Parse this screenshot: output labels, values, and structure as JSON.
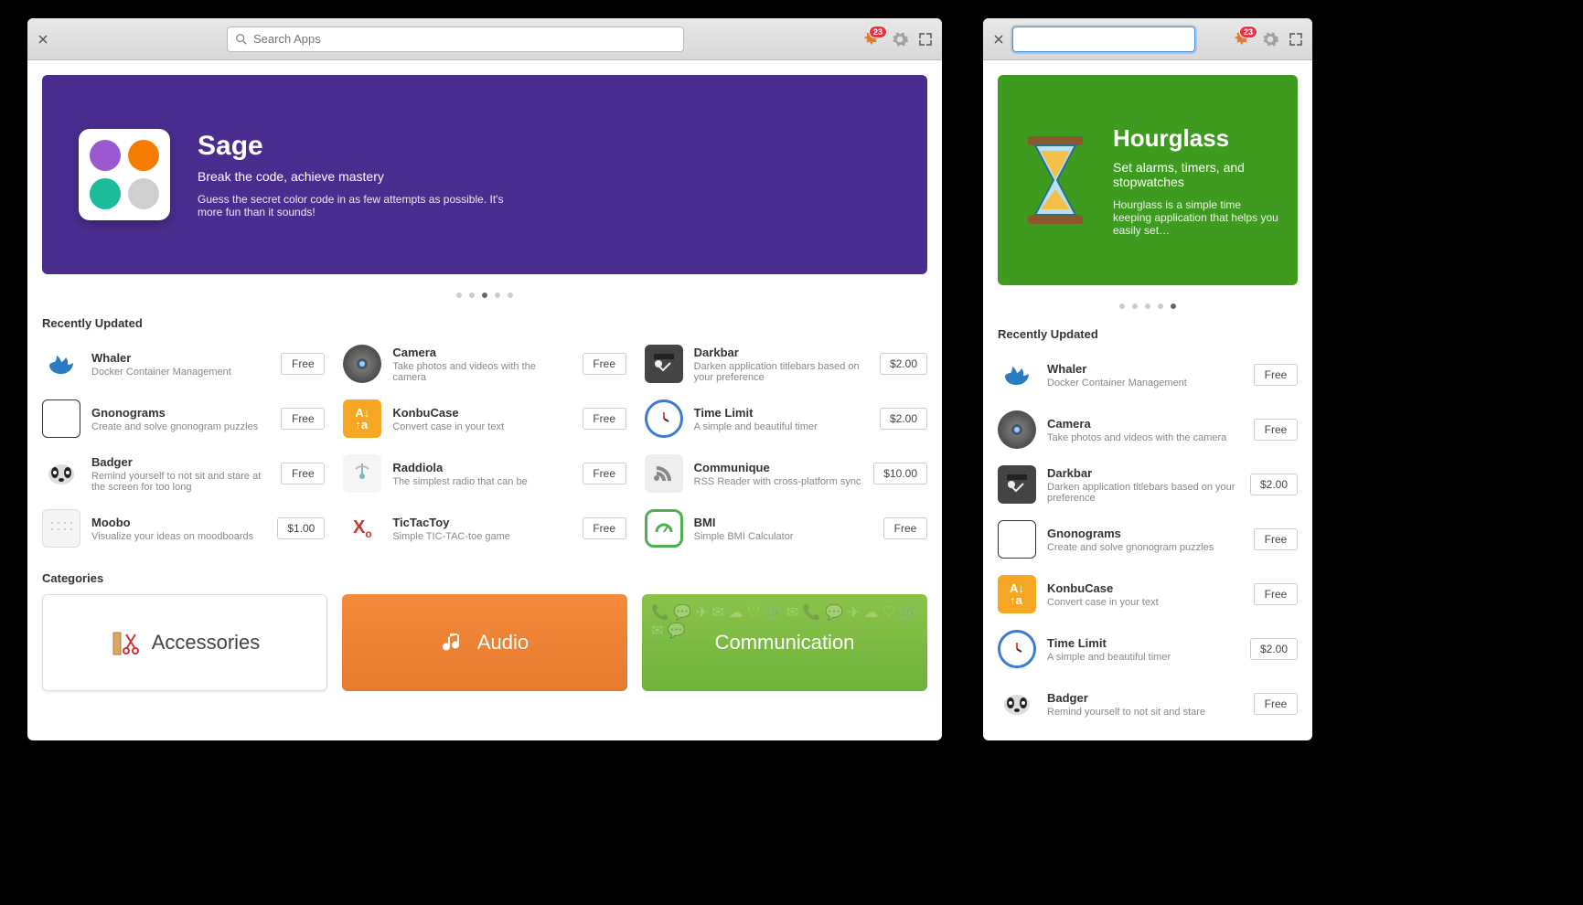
{
  "search_placeholder": "Search Apps",
  "update_count": "23",
  "hero_a": {
    "title": "Sage",
    "subtitle": "Break the code, achieve mastery",
    "description": "Guess the secret color code in as few attempts as possible. It's more fun than it sounds!",
    "icon_colors": [
      "#9b59d0",
      "#f57c00",
      "#1abc9c",
      "#cfcfcf"
    ]
  },
  "hero_b": {
    "title": "Hourglass",
    "subtitle": "Set alarms, timers, and stopwatches",
    "description": "Hourglass is a simple time keeping application that helps you easily set…"
  },
  "section_recent": "Recently Updated",
  "section_categories": "Categories",
  "apps_a": [
    {
      "name": "Whaler",
      "desc": "Docker Container Management",
      "price": "Free",
      "icon": "ic-whale"
    },
    {
      "name": "Camera",
      "desc": "Take photos and videos with the camera",
      "price": "Free",
      "icon": "ic-cam"
    },
    {
      "name": "Darkbar",
      "desc": "Darken application titlebars based on your preference",
      "price": "$2.00",
      "icon": "ic-dark"
    },
    {
      "name": "Gnonograms",
      "desc": "Create and solve gnonogram puzzles",
      "price": "Free",
      "icon": "ic-grid2"
    },
    {
      "name": "KonbuCase",
      "desc": "Convert case in your text",
      "price": "Free",
      "icon": "ic-konbu"
    },
    {
      "name": "Time Limit",
      "desc": "A simple and beautiful timer",
      "price": "$2.00",
      "icon": "ic-clock"
    },
    {
      "name": "Badger",
      "desc": "Remind yourself to not sit and stare at the screen for too long",
      "price": "Free",
      "icon": "ic-badger"
    },
    {
      "name": "Raddiola",
      "desc": "The simplest radio that can be",
      "price": "Free",
      "icon": "ic-radio"
    },
    {
      "name": "Communique",
      "desc": "RSS Reader with cross-platform sync",
      "price": "$10.00",
      "icon": "ic-rss"
    },
    {
      "name": "Moobo",
      "desc": "Visualize your ideas on moodboards",
      "price": "$1.00",
      "icon": "ic-moobo"
    },
    {
      "name": "TicTacToy",
      "desc": "Simple TIC-TAC-toe game",
      "price": "Free",
      "icon": "ic-ttt"
    },
    {
      "name": "BMI",
      "desc": "Simple BMI Calculator",
      "price": "Free",
      "icon": "ic-bmi"
    }
  ],
  "apps_b": [
    {
      "name": "Whaler",
      "desc": "Docker Container Management",
      "price": "Free",
      "icon": "ic-whale"
    },
    {
      "name": "Camera",
      "desc": "Take photos and videos with the camera",
      "price": "Free",
      "icon": "ic-cam"
    },
    {
      "name": "Darkbar",
      "desc": "Darken application titlebars based on your preference",
      "price": "$2.00",
      "icon": "ic-dark"
    },
    {
      "name": "Gnonograms",
      "desc": "Create and solve gnonogram puzzles",
      "price": "Free",
      "icon": "ic-grid2"
    },
    {
      "name": "KonbuCase",
      "desc": "Convert case in your text",
      "price": "Free",
      "icon": "ic-konbu"
    },
    {
      "name": "Time Limit",
      "desc": "A simple and beautiful timer",
      "price": "$2.00",
      "icon": "ic-clock"
    },
    {
      "name": "Badger",
      "desc": "Remind yourself to not sit and stare",
      "price": "Free",
      "icon": "ic-badger"
    }
  ],
  "categories": [
    {
      "label": "Accessories",
      "cls": "cat-acc"
    },
    {
      "label": "Audio",
      "cls": "cat-aud"
    },
    {
      "label": "Communication",
      "cls": "cat-com"
    }
  ],
  "dots_a_active": 2,
  "dots_b_active": 4
}
